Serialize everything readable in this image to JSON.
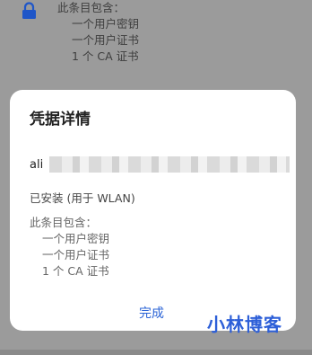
{
  "background": {
    "contains_label": "此条目包含：",
    "items": [
      "一个用户密钥",
      "一个用户证书",
      "1 个 CA 证书"
    ]
  },
  "dialog": {
    "title": "凭据详情",
    "credential_name_prefix": "ali",
    "installed_text": "已安装 (用于 WLAN)",
    "contains_label": "此条目包含：",
    "items": [
      "一个用户密钥",
      "一个用户证书",
      "1 个 CA 证书"
    ],
    "done_label": "完成"
  },
  "watermark": "小林博客",
  "colors": {
    "accent": "#2a63d6",
    "scrim": "#9b9b9b"
  },
  "icons": {
    "lock": "lock-icon"
  }
}
